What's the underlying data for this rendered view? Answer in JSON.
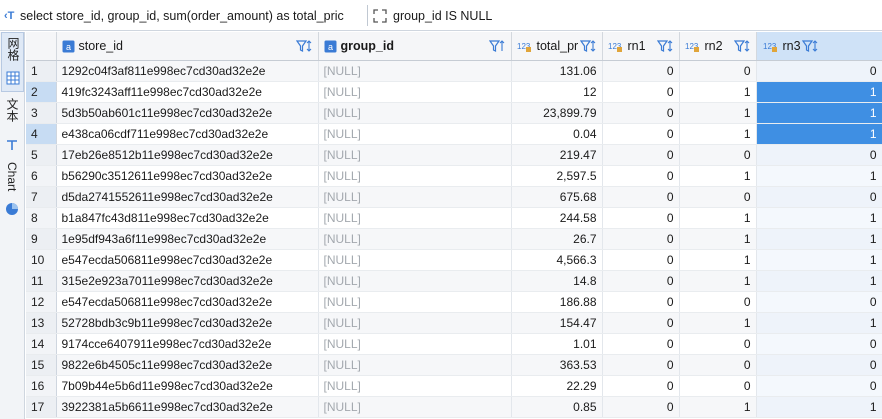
{
  "toolbar": {
    "query_icon": "sql-query-icon",
    "query_text": "select store_id, group_id, sum(order_amount) as total_pric",
    "expand_icon": "expand-icon",
    "filter_text": "group_id IS NULL"
  },
  "side_tabs": [
    {
      "label": "网格",
      "icon": "grid-icon"
    },
    {
      "label": "文本",
      "icon": "text-icon"
    },
    {
      "label": "Chart",
      "icon": "chart-icon"
    }
  ],
  "columns": [
    {
      "label": "store_id",
      "icon": "text-type-icon",
      "sort_icon": "filter-sort-icon"
    },
    {
      "label": "group_id",
      "icon": "text-type-icon",
      "sort_icon": "filter-sort-icon"
    },
    {
      "label": "total_price",
      "icon": "number-type-icon",
      "type_glyph": "123",
      "sort_icon": "filter-sort-icon"
    },
    {
      "label": "rn1",
      "icon": "number-type-icon",
      "type_glyph": "123",
      "sort_icon": "filter-sort-icon"
    },
    {
      "label": "rn2",
      "icon": "number-type-icon",
      "type_glyph": "123",
      "sort_icon": "filter-sort-icon"
    },
    {
      "label": "rn3",
      "icon": "number-type-icon",
      "type_glyph": "123",
      "sort_icon": "filter-sort-icon"
    }
  ],
  "rows": [
    {
      "n": "1",
      "store_id": "1292c04f3af811e998ec7cd30ad32e2e",
      "group_id": "[NULL]",
      "total_price": "131.06",
      "rn1": "0",
      "rn2": "0",
      "rn3": "0"
    },
    {
      "n": "2",
      "store_id": "419fc3243aff11e998ec7cd30ad32e2e",
      "group_id": "[NULL]",
      "total_price": "12",
      "rn1": "0",
      "rn2": "1",
      "rn3": "1"
    },
    {
      "n": "3",
      "store_id": "5d3b50ab601c11e998ec7cd30ad32e2e",
      "group_id": "[NULL]",
      "total_price": "23,899.79",
      "rn1": "0",
      "rn2": "1",
      "rn3": "1"
    },
    {
      "n": "4",
      "store_id": "e438ca06cdf711e998ec7cd30ad32e2e",
      "group_id": "[NULL]",
      "total_price": "0.04",
      "rn1": "0",
      "rn2": "1",
      "rn3": "1"
    },
    {
      "n": "5",
      "store_id": "17eb26e8512b11e998ec7cd30ad32e2e",
      "group_id": "[NULL]",
      "total_price": "219.47",
      "rn1": "0",
      "rn2": "0",
      "rn3": "0"
    },
    {
      "n": "6",
      "store_id": "b56290c3512611e998ec7cd30ad32e2e",
      "group_id": "[NULL]",
      "total_price": "2,597.5",
      "rn1": "0",
      "rn2": "1",
      "rn3": "1"
    },
    {
      "n": "7",
      "store_id": "d5da2741552611e998ec7cd30ad32e2e",
      "group_id": "[NULL]",
      "total_price": "675.68",
      "rn1": "0",
      "rn2": "0",
      "rn3": "0"
    },
    {
      "n": "8",
      "store_id": "b1a847fc43d811e998ec7cd30ad32e2e",
      "group_id": "[NULL]",
      "total_price": "244.58",
      "rn1": "0",
      "rn2": "1",
      "rn3": "1"
    },
    {
      "n": "9",
      "store_id": "1e95df943a6f11e998ec7cd30ad32e2e",
      "group_id": "[NULL]",
      "total_price": "26.7",
      "rn1": "0",
      "rn2": "1",
      "rn3": "1"
    },
    {
      "n": "10",
      "store_id": "e547ecda506811e998ec7cd30ad32e2e",
      "group_id": "[NULL]",
      "total_price": "4,566.3",
      "rn1": "0",
      "rn2": "1",
      "rn3": "1"
    },
    {
      "n": "11",
      "store_id": "315e2e923a7011e998ec7cd30ad32e2e",
      "group_id": "[NULL]",
      "total_price": "14.8",
      "rn1": "0",
      "rn2": "1",
      "rn3": "1"
    },
    {
      "n": "12",
      "store_id": "e547ecda506811e998ec7cd30ad32e2e",
      "group_id": "[NULL]",
      "total_price": "186.88",
      "rn1": "0",
      "rn2": "0",
      "rn3": "0"
    },
    {
      "n": "13",
      "store_id": "52728bdb3c9b11e998ec7cd30ad32e2e",
      "group_id": "[NULL]",
      "total_price": "154.47",
      "rn1": "0",
      "rn2": "1",
      "rn3": "1"
    },
    {
      "n": "14",
      "store_id": "9174cce6407911e998ec7cd30ad32e2e",
      "group_id": "[NULL]",
      "total_price": "1.01",
      "rn1": "0",
      "rn2": "0",
      "rn3": "0"
    },
    {
      "n": "15",
      "store_id": "9822e6b4505c11e998ec7cd30ad32e2e",
      "group_id": "[NULL]",
      "total_price": "363.53",
      "rn1": "0",
      "rn2": "0",
      "rn3": "0"
    },
    {
      "n": "16",
      "store_id": "7b09b44e5b6d11e998ec7cd30ad32e2e",
      "group_id": "[NULL]",
      "total_price": "22.29",
      "rn1": "0",
      "rn2": "0",
      "rn3": "0"
    },
    {
      "n": "17",
      "store_id": "3922381a5b6611e998ec7cd30ad32e2e",
      "group_id": "[NULL]",
      "total_price": "0.85",
      "rn1": "0",
      "rn2": "1",
      "rn3": "1"
    }
  ],
  "selected_rows": [
    "2",
    "4"
  ],
  "highlighted_cells": [
    {
      "row": "2",
      "col": "rn3"
    },
    {
      "row": "3",
      "col": "rn3"
    },
    {
      "row": "4",
      "col": "rn3"
    }
  ],
  "colors": {
    "accent": "#3f8fe3",
    "selected_header": "#cfe2f7",
    "row_selected": "#c7dcf3",
    "null_text": "#a3a8ae"
  }
}
